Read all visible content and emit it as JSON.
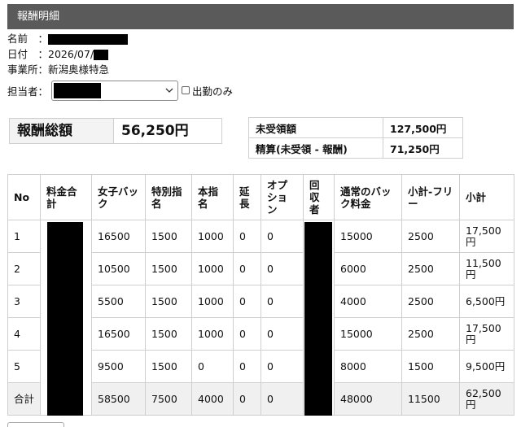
{
  "header": {
    "title": "報酬明細"
  },
  "info": {
    "name_label": "名前　：",
    "date_label": "日付　：",
    "date_value": "2026/07/",
    "office_label": "事業所：",
    "office_value": "新潟奥様特急"
  },
  "staff": {
    "label": "担当者：",
    "checkbox_label": "出勤のみ",
    "checked": false
  },
  "total": {
    "label": "報酬総額",
    "value": "56,250円"
  },
  "summary": [
    {
      "label": "未受領額",
      "value": "127,500円"
    },
    {
      "label": "精算(未受領 - 報酬)",
      "value": "71,250円"
    }
  ],
  "table": {
    "headers": [
      "No",
      "料金合計",
      "女子バック",
      "特別指名",
      "本指名",
      "延長",
      "オプション",
      "回収者",
      "通常のバック料金",
      "小計-フリー",
      "小計"
    ],
    "rows": [
      {
        "no": "1",
        "girl_back": "16500",
        "special": "1500",
        "main": "1000",
        "ext": "0",
        "option": "0",
        "normal_back": "15000",
        "sub_free": "2500",
        "subtotal": "17,500円"
      },
      {
        "no": "2",
        "girl_back": "10500",
        "special": "1500",
        "main": "1000",
        "ext": "0",
        "option": "0",
        "normal_back": "6000",
        "sub_free": "2500",
        "subtotal": "11,500円"
      },
      {
        "no": "3",
        "girl_back": "5500",
        "special": "1500",
        "main": "1000",
        "ext": "0",
        "option": "0",
        "normal_back": "4000",
        "sub_free": "2500",
        "subtotal": "6,500円"
      },
      {
        "no": "4",
        "girl_back": "16500",
        "special": "1500",
        "main": "1000",
        "ext": "0",
        "option": "0",
        "normal_back": "15000",
        "sub_free": "2500",
        "subtotal": "17,500円"
      },
      {
        "no": "5",
        "girl_back": "9500",
        "special": "1500",
        "main": "0",
        "ext": "0",
        "option": "0",
        "normal_back": "8000",
        "sub_free": "1500",
        "subtotal": "9,500円"
      }
    ],
    "total_row": {
      "no": "合計",
      "girl_back": "58500",
      "special": "7500",
      "main": "4000",
      "ext": "0",
      "option": "0",
      "normal_back": "48000",
      "sub_free": "11500",
      "subtotal": "62,500円"
    }
  }
}
